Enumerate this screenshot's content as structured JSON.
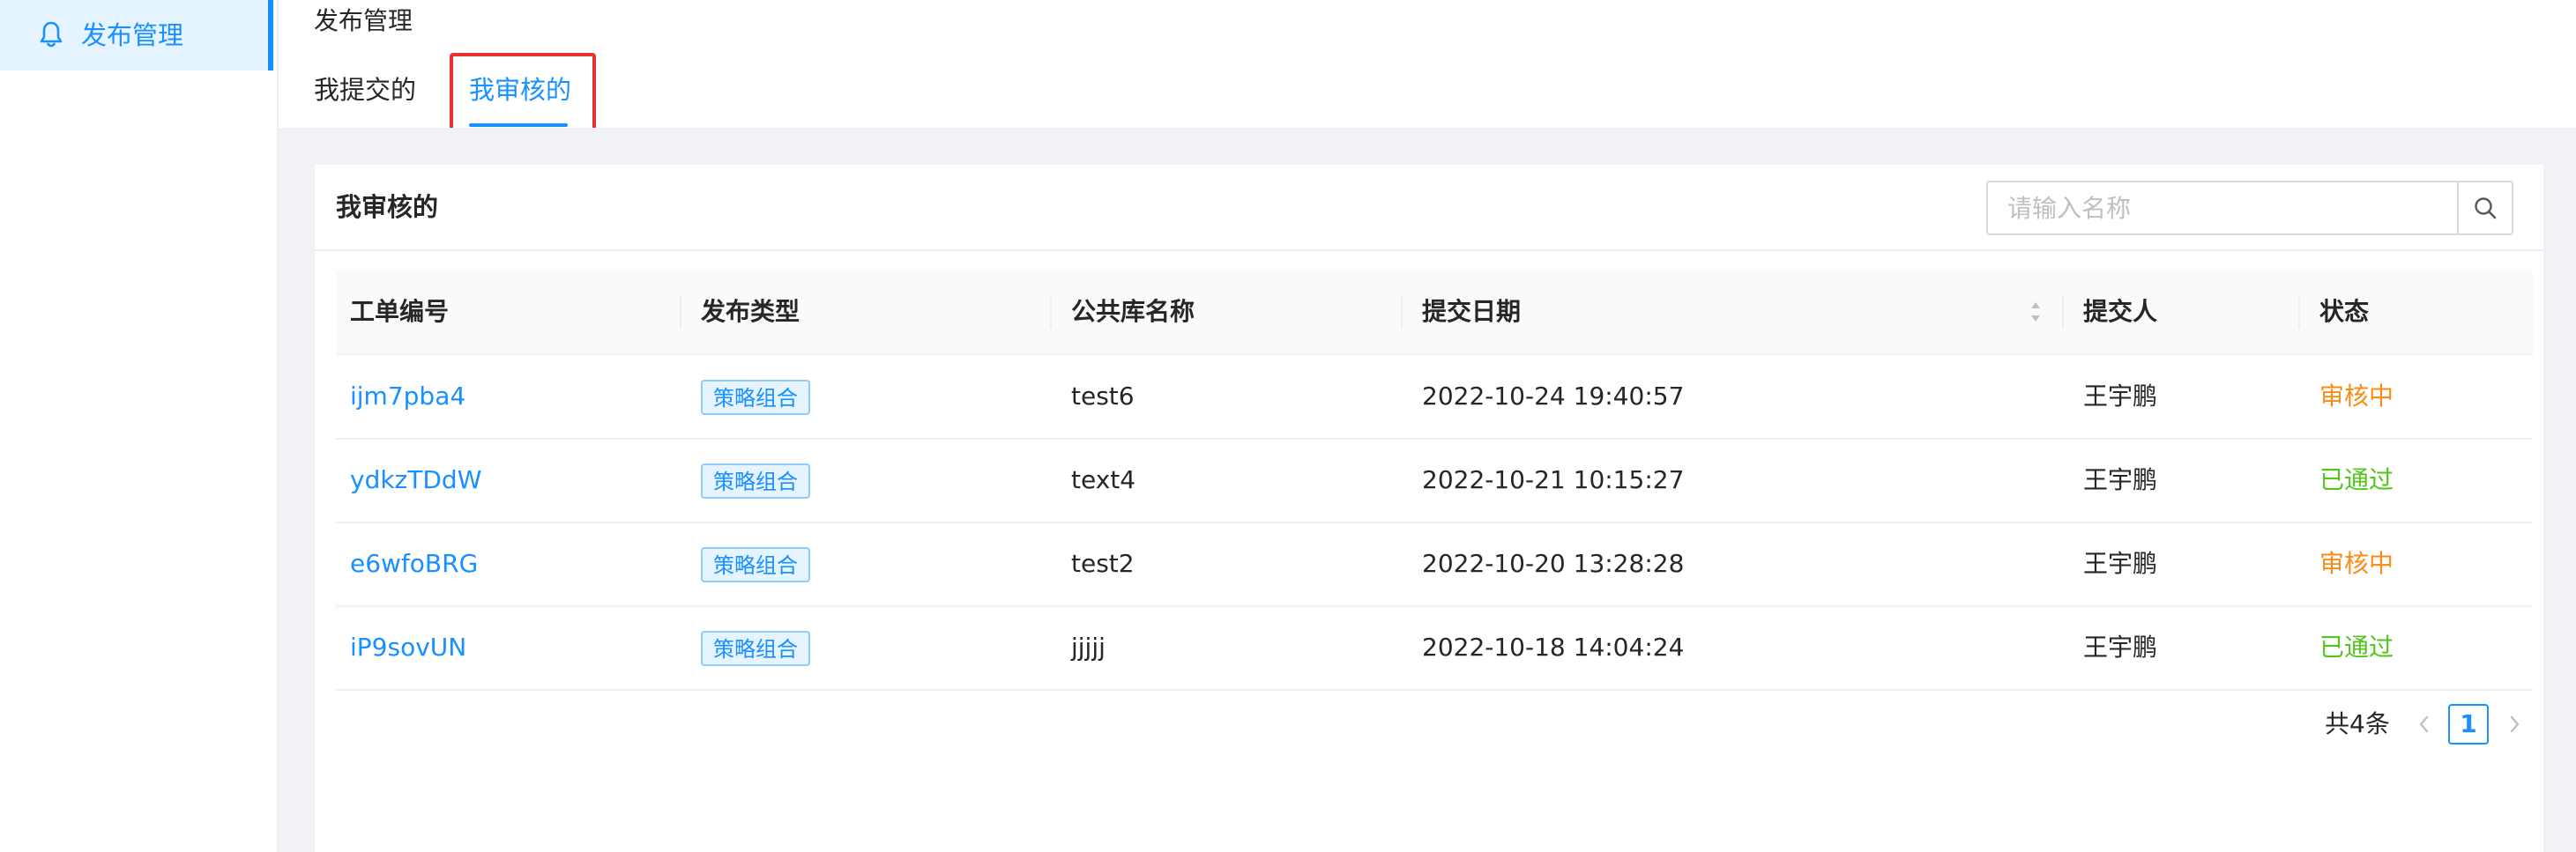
{
  "sidebar": {
    "items": [
      {
        "label": "发布管理",
        "icon": "bell-icon",
        "active": true
      }
    ]
  },
  "header": {
    "title": "发布管理",
    "tabs": [
      {
        "label": "我提交的",
        "active": false
      },
      {
        "label": "我审核的",
        "active": true
      }
    ]
  },
  "card": {
    "title": "我审核的",
    "search": {
      "placeholder": "请输入名称",
      "value": "",
      "icon": "search-icon"
    }
  },
  "table": {
    "columns": [
      "工单编号",
      "发布类型",
      "公共库名称",
      "提交日期",
      "提交人",
      "状态"
    ],
    "rows": [
      {
        "id": "ijm7pba4",
        "type": "策略组合",
        "library": "test6",
        "date": "2022-10-24 19:40:57",
        "submitter": "王宇鹏",
        "status": "审核中"
      },
      {
        "id": "ydkzTDdW",
        "type": "策略组合",
        "library": "text4",
        "date": "2022-10-21 10:15:27",
        "submitter": "王宇鹏",
        "status": "已通过"
      },
      {
        "id": "e6wfoBRG",
        "type": "策略组合",
        "library": "test2",
        "date": "2022-10-20 13:28:28",
        "submitter": "王宇鹏",
        "status": "审核中"
      },
      {
        "id": "iP9sovUN",
        "type": "策略组合",
        "library": "jjjjj",
        "date": "2022-10-18 14:04:24",
        "submitter": "王宇鹏",
        "status": "已通过"
      }
    ]
  },
  "pagination": {
    "total_label": "共4条",
    "current_page": "1"
  },
  "colors": {
    "accent": "#1890ff",
    "pending": "#fa8c16",
    "approved": "#52c41a",
    "highlight": "#e8322d"
  }
}
